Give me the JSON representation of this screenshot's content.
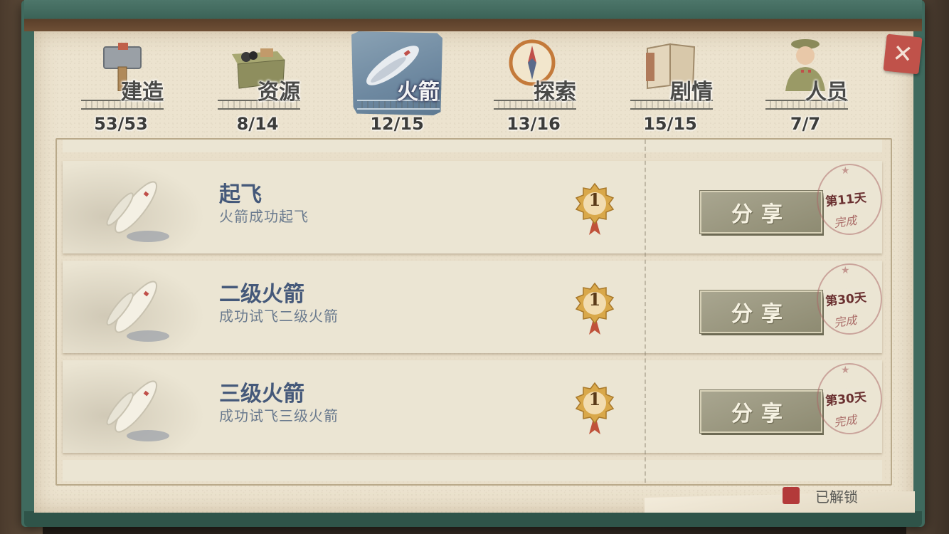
{
  "tabs": [
    {
      "label": "建造",
      "count": "53/53",
      "icon": "hammer-icon",
      "active": false
    },
    {
      "label": "资源",
      "count": "8/14",
      "icon": "resource-crate-icon",
      "active": false
    },
    {
      "label": "火箭",
      "count": "12/15",
      "icon": "rocket-icon",
      "active": true
    },
    {
      "label": "探索",
      "count": "13/16",
      "icon": "compass-icon",
      "active": false
    },
    {
      "label": "剧情",
      "count": "15/15",
      "icon": "book-icon",
      "active": false
    },
    {
      "label": "人员",
      "count": "7/7",
      "icon": "soldier-icon",
      "active": false
    }
  ],
  "close": {
    "symbol": "✕"
  },
  "achievements": [
    {
      "title": "起飞",
      "desc": "火箭成功起飞",
      "medal": "1",
      "share": "分享",
      "day": "第11天",
      "stamp": "完成"
    },
    {
      "title": "二级火箭",
      "desc": "成功试飞二级火箭",
      "medal": "1",
      "share": "分享",
      "day": "第30天",
      "stamp": "完成"
    },
    {
      "title": "三级火箭",
      "desc": "成功试飞三级火箭",
      "medal": "1",
      "share": "分享",
      "day": "第30天",
      "stamp": "完成"
    }
  ],
  "legend": {
    "text": "已解锁",
    "color": "#b33a3a"
  },
  "colors": {
    "frame": "#3f6a5e",
    "page": "#ece3cf",
    "title": "#45597a",
    "share_button": "#9a9780"
  }
}
